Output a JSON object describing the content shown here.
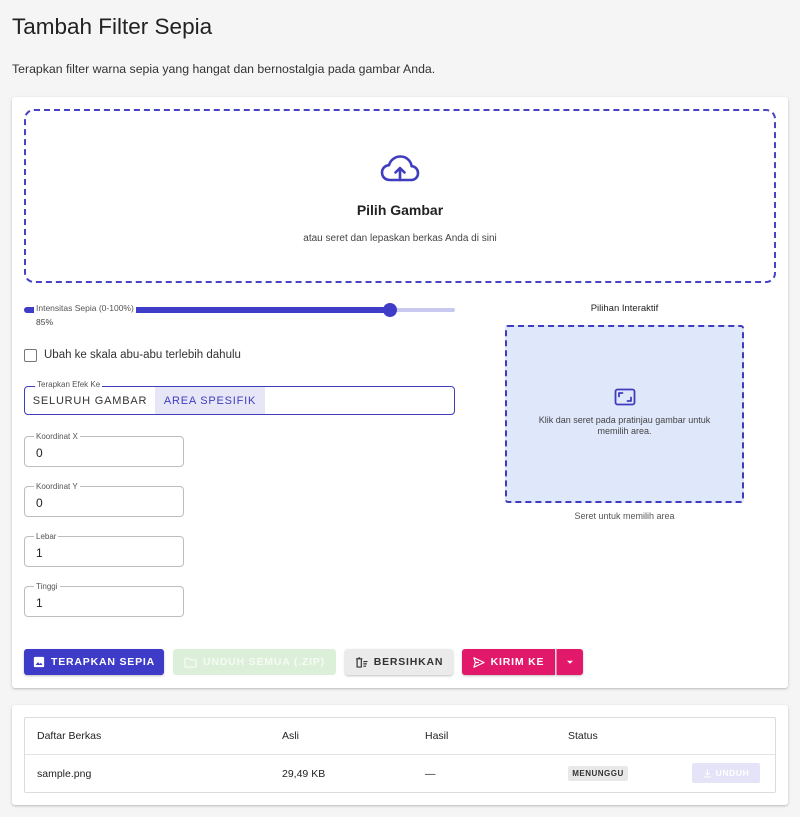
{
  "page": {
    "title": "Tambah Filter Sepia",
    "subtitle": "Terapkan filter warna sepia yang hangat dan bernostalgia pada gambar Anda."
  },
  "dropzone": {
    "icon": "cloud-upload-icon",
    "title": "Pilih Gambar",
    "hint": "atau seret dan lepaskan berkas Anda di sini"
  },
  "controls": {
    "intensity": {
      "label": "Intensitas Sepia (0-100%)",
      "value": 85,
      "min": 0,
      "max": 100,
      "value_text": "85%"
    },
    "grayscale": {
      "label": "Ubah ke skala abu-abu terlebih dahulu",
      "checked": false
    },
    "apply_to": {
      "label": "Terapkan Efek Ke",
      "options": [
        {
          "label": "SELURUH GAMBAR",
          "selected": false
        },
        {
          "label": "AREA SPESIFIK",
          "selected": true
        }
      ]
    },
    "fields": [
      {
        "label": "Koordinat X",
        "value": "0"
      },
      {
        "label": "Koordinat Y",
        "value": "0"
      },
      {
        "label": "Lebar",
        "value": "1"
      },
      {
        "label": "Tinggi",
        "value": "1"
      }
    ]
  },
  "interactive": {
    "title": "Pilihan Interaktif",
    "icon": "select-area-icon",
    "hint": "Klik dan seret pada pratinjau gambar untuk memilih area.",
    "caption": "Seret untuk memilih area"
  },
  "actions": {
    "apply": {
      "label": "TERAPKAN SEPIA",
      "icon": "image-icon",
      "enabled": true
    },
    "download_all": {
      "label": "UNDUH SEMUA (.ZIP)",
      "icon": "folder-icon",
      "enabled": false
    },
    "clear": {
      "label": "BERSIHKAN",
      "icon": "clear-icon",
      "enabled": true
    },
    "send": {
      "label": "KIRIM KE",
      "icon": "send-icon",
      "menu_icon": "caret-down-icon",
      "enabled": true
    }
  },
  "files": {
    "columns": [
      "Daftar Berkas",
      "Asli",
      "Hasil",
      "Status"
    ],
    "rows": [
      {
        "name": "sample.png",
        "original": "29,49 KB",
        "result": "—",
        "status": "MENUNGGU",
        "action": {
          "label": "UNDUH",
          "icon": "download-icon",
          "enabled": false
        }
      }
    ]
  },
  "colors": {
    "primary": "#3f3dbd",
    "accent": "#e2186a",
    "selection_area": "#dfe7fb",
    "download_disabled": "#dcefd9",
    "page_background": "#f5f5f5"
  }
}
